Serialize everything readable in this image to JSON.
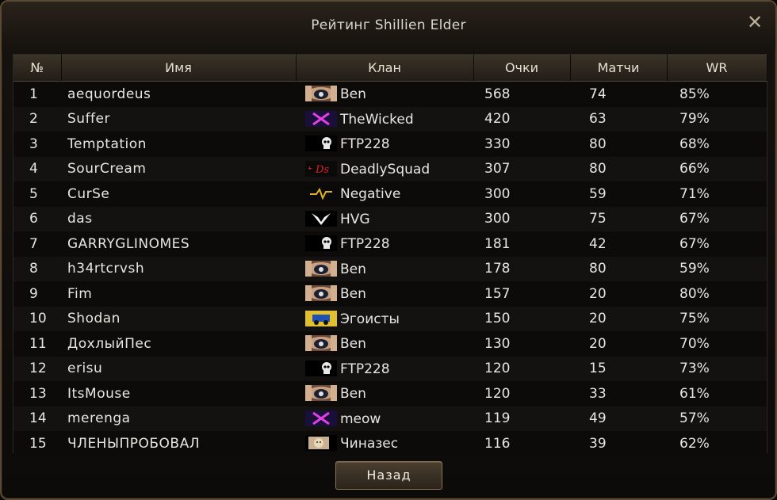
{
  "window": {
    "title": "Рейтинг Shillien Elder",
    "close_icon": "close-icon"
  },
  "table": {
    "headers": {
      "num": "№",
      "name": "Имя",
      "clan": "Клан",
      "points": "Очки",
      "matches": "Матчи",
      "wr": "WR"
    },
    "rows": [
      {
        "num": "1",
        "name": "aequordeus",
        "clan": "Ben",
        "crest": "ben",
        "points": "568",
        "matches": "74",
        "wr": "85%"
      },
      {
        "num": "2",
        "name": "Suffer",
        "clan": "TheWicked",
        "crest": "purple-x",
        "points": "420",
        "matches": "63",
        "wr": "79%"
      },
      {
        "num": "3",
        "name": "Temptation",
        "clan": "FTP228",
        "crest": "skull",
        "points": "330",
        "matches": "80",
        "wr": "68%"
      },
      {
        "num": "4",
        "name": "SourCream",
        "clan": "DeadlySquad",
        "crest": "ds",
        "points": "307",
        "matches": "80",
        "wr": "66%"
      },
      {
        "num": "5",
        "name": "CurSe",
        "clan": "Negative",
        "crest": "wave",
        "points": "300",
        "matches": "59",
        "wr": "71%"
      },
      {
        "num": "6",
        "name": "das",
        "clan": "HVG",
        "crest": "wings",
        "points": "300",
        "matches": "75",
        "wr": "67%"
      },
      {
        "num": "7",
        "name": "GARRYGLINOMES",
        "clan": "FTP228",
        "crest": "skull",
        "points": "181",
        "matches": "42",
        "wr": "67%"
      },
      {
        "num": "8",
        "name": "h34rtcrvsh",
        "clan": "Ben",
        "crest": "ben",
        "points": "178",
        "matches": "80",
        "wr": "59%"
      },
      {
        "num": "9",
        "name": "Fim",
        "clan": "Ben",
        "crest": "ben",
        "points": "157",
        "matches": "20",
        "wr": "80%"
      },
      {
        "num": "10",
        "name": "Shodan",
        "clan": "Эгоисты",
        "crest": "car",
        "points": "150",
        "matches": "20",
        "wr": "75%"
      },
      {
        "num": "11",
        "name": "ДохлыйПес",
        "clan": "Ben",
        "crest": "ben",
        "points": "130",
        "matches": "20",
        "wr": "70%"
      },
      {
        "num": "12",
        "name": "erisu",
        "clan": "FTP228",
        "crest": "skull",
        "points": "120",
        "matches": "15",
        "wr": "73%"
      },
      {
        "num": "13",
        "name": "ItsMouse",
        "clan": "Ben",
        "crest": "ben",
        "points": "120",
        "matches": "33",
        "wr": "61%"
      },
      {
        "num": "14",
        "name": "merenga",
        "clan": "meow",
        "crest": "purple-x",
        "points": "119",
        "matches": "49",
        "wr": "57%"
      },
      {
        "num": "15",
        "name": "ЧЛЕНЫПРОБОВАЛ",
        "clan": "Чиназес",
        "crest": "cat",
        "points": "116",
        "matches": "39",
        "wr": "62%"
      }
    ]
  },
  "footer": {
    "back_label": "Назад"
  },
  "colors": {
    "frame": "#5a4a34",
    "text": "#e8e6e0",
    "header_bg": "#3a3328"
  }
}
